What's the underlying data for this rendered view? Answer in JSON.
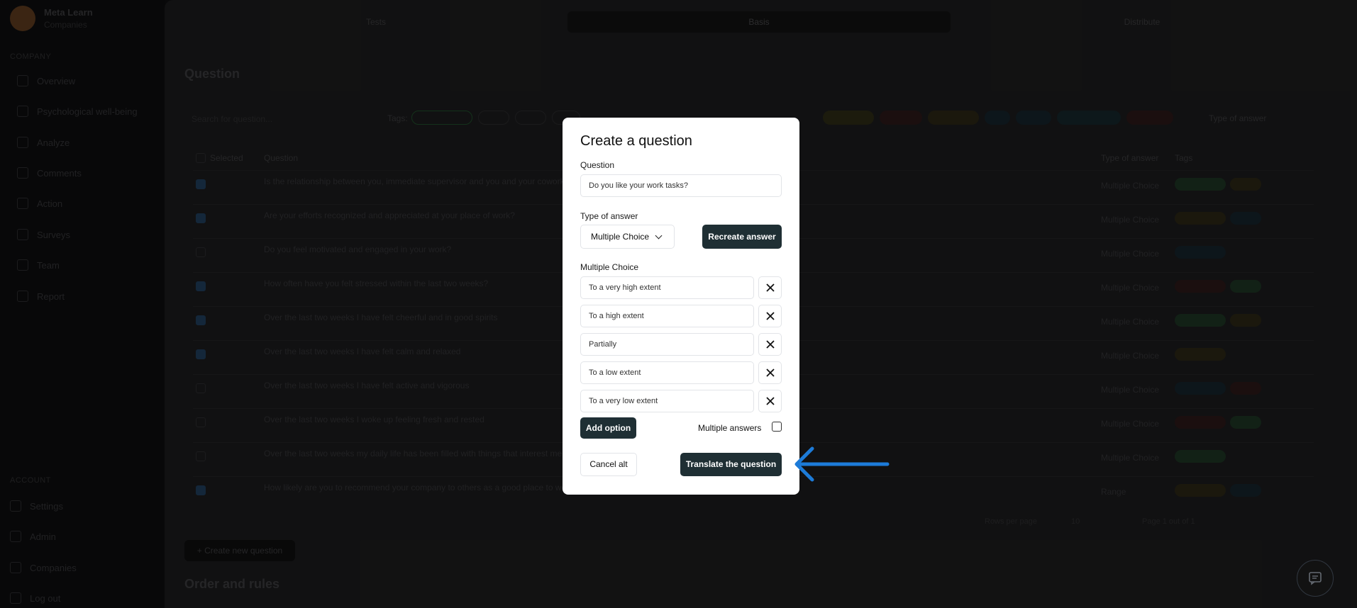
{
  "sidebar": {
    "brand_title": "Meta Learn",
    "brand_subtitle": "Companies",
    "section_company": "COMPANY",
    "items": [
      {
        "label": "Overview",
        "icon": "home-icon"
      },
      {
        "label": "Psychological well-being",
        "icon": "heart-icon"
      },
      {
        "label": "Analyze",
        "icon": "chart-icon"
      },
      {
        "label": "Comments",
        "icon": "comment-icon"
      },
      {
        "label": "Action",
        "icon": "action-icon"
      },
      {
        "label": "Surveys",
        "icon": "survey-icon"
      },
      {
        "label": "Team",
        "icon": "team-icon"
      },
      {
        "label": "Report",
        "icon": "report-icon"
      }
    ],
    "section_account": "ACCOUNT",
    "account_items": [
      {
        "label": "Settings",
        "icon": "gear-icon"
      },
      {
        "label": "Admin",
        "icon": "admin-icon"
      },
      {
        "label": "Companies",
        "icon": "building-icon"
      },
      {
        "label": "Log out",
        "icon": "logout-icon"
      }
    ]
  },
  "tabs": [
    "Tests",
    "Basis",
    "Distribute"
  ],
  "active_tab": "Basis",
  "page": {
    "question_heading": "Question",
    "create_new_question": "Create new question",
    "order_heading": "Order and rules",
    "search_placeholder": "Search for question...",
    "tags_label": "Tags:",
    "type_of_answer_filter": "Type of answer",
    "col_selected": "Selected",
    "col_question": "Question",
    "col_answer": "Type of answer",
    "col_tags": "Tags",
    "rows_per_page": "Rows per page",
    "rows_value": "10",
    "page_of": "Page 1 out of 1"
  },
  "table_rows": [
    {
      "checked": true,
      "question": "Is the relationship between you, immediate supervisor and you and your coworkers...",
      "answer": "Multiple Choice"
    },
    {
      "checked": true,
      "question": "Are your efforts recognized and appreciated at your place of work?",
      "answer": "Multiple Choice"
    },
    {
      "checked": false,
      "question": "Do you feel motivated and engaged in your work?",
      "answer": "Multiple Choice"
    },
    {
      "checked": true,
      "question": "How often have you felt stressed within the last two weeks?",
      "answer": "Multiple Choice"
    },
    {
      "checked": true,
      "question": "Over the last two weeks I have felt cheerful and in good spirits",
      "answer": "Multiple Choice"
    },
    {
      "checked": true,
      "question": "Over the last two weeks I have felt calm and relaxed",
      "answer": "Multiple Choice"
    },
    {
      "checked": false,
      "question": "Over the last two weeks I have felt active and vigorous",
      "answer": "Multiple Choice"
    },
    {
      "checked": false,
      "question": "Over the last two weeks I woke up feeling fresh and rested",
      "answer": "Multiple Choice"
    },
    {
      "checked": false,
      "question": "Over the last two weeks my daily life has been filled with things that interest me",
      "answer": "Multiple Choice"
    },
    {
      "checked": true,
      "question": "How likely are you to recommend your company to others as a good place to work?",
      "answer": "Range"
    }
  ],
  "modal": {
    "title": "Create a question",
    "question_label": "Question",
    "question_value": "Do you like your work tasks?",
    "type_label": "Type of answer",
    "type_value": "Multiple Choice",
    "recreate_button": "Recreate answer",
    "choices_label": "Multiple Choice",
    "options": [
      "To a very high extent",
      "To a high extent",
      "Partially",
      "To a low extent",
      "To a very low extent"
    ],
    "add_option": "Add option",
    "multiple_answers": "Multiple answers",
    "cancel": "Cancel alt",
    "translate": "Translate the question"
  },
  "colors": {
    "dark_button": "#1f2f34",
    "arrow": "#1d7bd8",
    "overlay": "#000000"
  }
}
